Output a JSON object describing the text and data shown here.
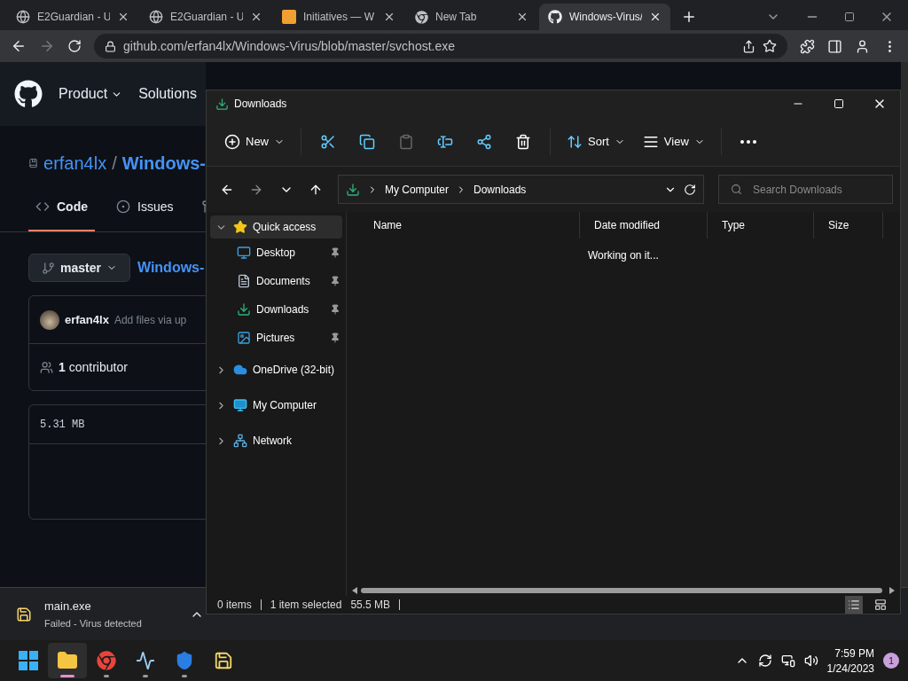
{
  "browser": {
    "tabs": [
      {
        "title": "E2Guardian - U",
        "selected": false
      },
      {
        "title": "E2Guardian - U",
        "selected": false
      },
      {
        "title": "Initiatives — W",
        "selected": false
      },
      {
        "title": "New Tab",
        "selected": false
      },
      {
        "title": "Windows-Virus/",
        "selected": true
      }
    ],
    "url": "github.com/erfan4lx/Windows-Virus/blob/master/svchost.exe"
  },
  "github": {
    "nav": [
      {
        "label": "Product",
        "menu": true
      },
      {
        "label": "Solutions",
        "menu": false
      }
    ],
    "owner": "erfan4lx",
    "separator": "/",
    "repo": "Windows-",
    "tabs": [
      {
        "label": "Code",
        "selected": true
      },
      {
        "label": "Issues",
        "selected": false
      },
      {
        "selected": false
      }
    ],
    "branch": "master",
    "path": "Windows-",
    "commit": {
      "author": "erfan4lx",
      "message": "Add files via up"
    },
    "contributors": "**1** contributor",
    "file_size": "5.31 MB"
  },
  "explorer": {
    "title": "Downloads",
    "toolbar": [
      {
        "kind": "new",
        "label": "New",
        "disabled": false
      },
      {
        "kind": "cut",
        "disabled": false
      },
      {
        "kind": "copy",
        "disabled": false
      },
      {
        "kind": "paste",
        "disabled": true
      },
      {
        "kind": "rename",
        "disabled": false
      },
      {
        "kind": "share",
        "disabled": false
      },
      {
        "kind": "delete",
        "disabled": false
      },
      {
        "kind": "sort",
        "label": "Sort",
        "disabled": false
      },
      {
        "kind": "view",
        "label": "View",
        "disabled": false
      },
      {
        "kind": "more",
        "disabled": false
      }
    ],
    "nav_buttons": [
      {
        "kind": "back",
        "disabled": false
      },
      {
        "kind": "forward",
        "disabled": true
      },
      {
        "kind": "recent",
        "disabled": false
      },
      {
        "kind": "up",
        "disabled": false
      }
    ],
    "breadcrumb": [
      "My Computer",
      "Downloads"
    ],
    "search": {
      "placeholder": "Search Downloads"
    },
    "tree": [
      {
        "label": "Quick access",
        "kind": "star",
        "expanded": true,
        "selected": true,
        "children": [
          {
            "label": "Desktop",
            "kind": "desktop",
            "pinned": true,
            "selected": false
          },
          {
            "label": "Documents",
            "kind": "documents",
            "pinned": true,
            "selected": false
          },
          {
            "label": "Downloads",
            "kind": "downloads",
            "pinned": true,
            "selected": false
          },
          {
            "label": "Pictures",
            "kind": "pictures",
            "pinned": true,
            "selected": false
          }
        ]
      },
      {
        "label": "OneDrive (32-bit)",
        "kind": "cloud",
        "expanded": false,
        "selected": false
      },
      {
        "label": "My Computer",
        "kind": "computer",
        "expanded": false,
        "selected": false
      },
      {
        "label": "Network",
        "kind": "network",
        "expanded": false,
        "selected": false
      }
    ],
    "columns": [
      "Name",
      "Date modified",
      "Type",
      "Size"
    ],
    "message": "Working on it...",
    "status": {
      "items": "0 items",
      "selection": "1 item selected",
      "size": "55.5 MB"
    },
    "views": [
      {
        "kind": "details",
        "selected": true
      },
      {
        "kind": "tiles",
        "selected": false
      }
    ]
  },
  "download_shelf": {
    "file": "main.exe",
    "status": "Failed - Virus detected"
  },
  "taskbar": {
    "apps": [
      {
        "kind": "start",
        "running": false,
        "selected": false
      },
      {
        "kind": "files",
        "running": true,
        "selected": true
      },
      {
        "kind": "chrome",
        "running": true,
        "selected": false
      },
      {
        "kind": "monitor",
        "running": true,
        "selected": false
      },
      {
        "kind": "shield",
        "running": true,
        "selected": false
      },
      {
        "kind": "disk",
        "running": false,
        "selected": false
      }
    ],
    "time": "7:59 PM",
    "date": "1/24/2023",
    "notifications": "1"
  }
}
